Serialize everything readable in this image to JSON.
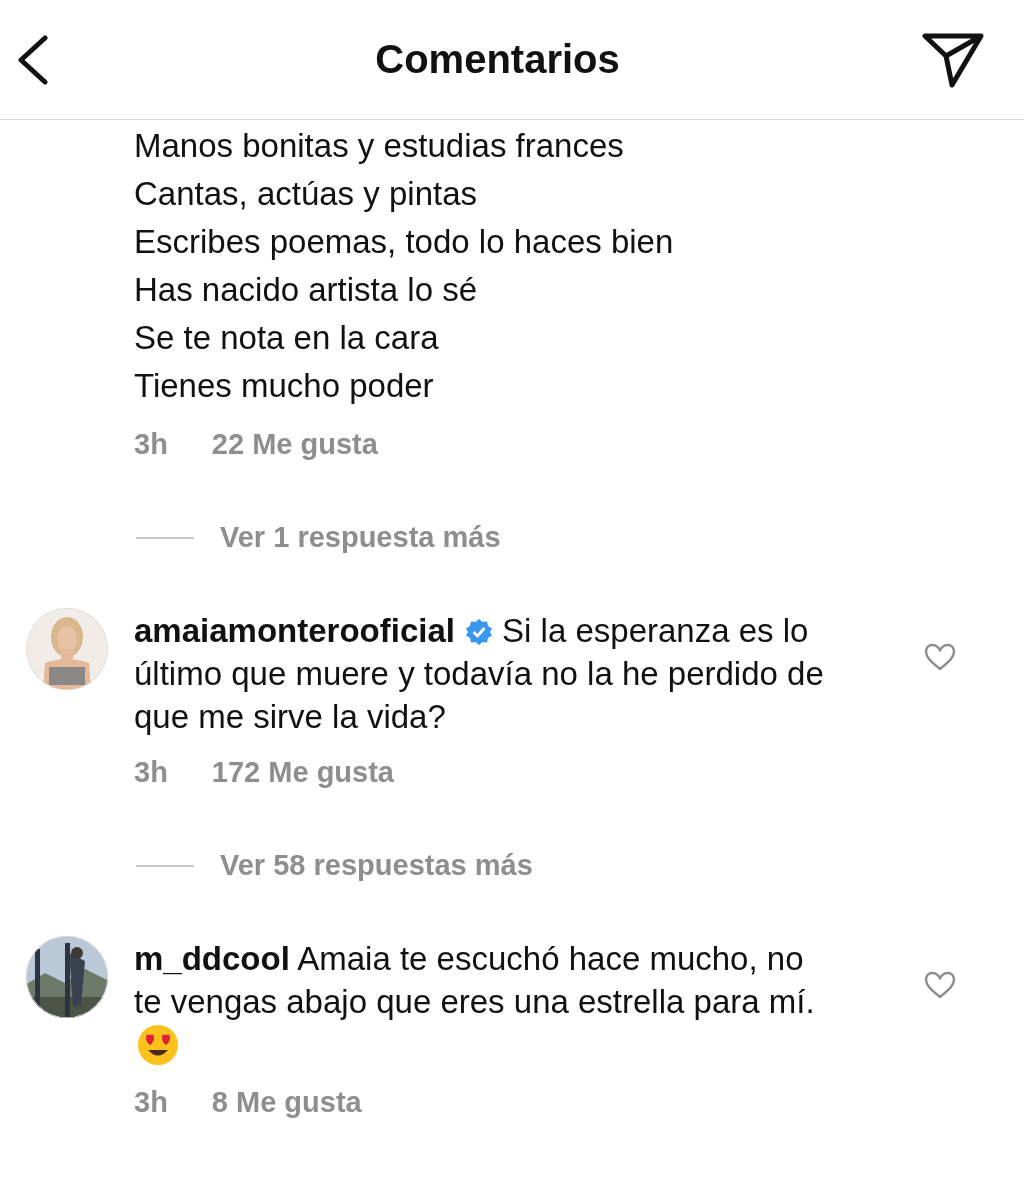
{
  "header": {
    "title": "Comentarios"
  },
  "caption": {
    "lines": [
      "Manos bonitas y estudias frances",
      "Cantas, actúas y pintas",
      "Escribes poemas, todo lo haces bien",
      "Has nacido artista lo sé",
      "Se te nota en la cara",
      "Tienes mucho poder"
    ],
    "time": "3h",
    "likes": "22 Me gusta",
    "replies": "Ver 1 respuesta más"
  },
  "comments": [
    {
      "username": "amaiamonterooficial",
      "verified": true,
      "text": "Si la esperanza es lo último que muere  y todavía no la he perdido de que me sirve la vida?",
      "emoji": false,
      "liked": false,
      "time": "3h",
      "likes": "172 Me gusta",
      "replies": "Ver 58 respuestas más"
    },
    {
      "username": "m_ddcool",
      "verified": false,
      "text": "Amaia te escuchó hace mucho, no te vengas abajo que eres una estrella para mí.",
      "emoji": true,
      "liked": false,
      "time": "3h",
      "likes": "8 Me gusta"
    }
  ]
}
